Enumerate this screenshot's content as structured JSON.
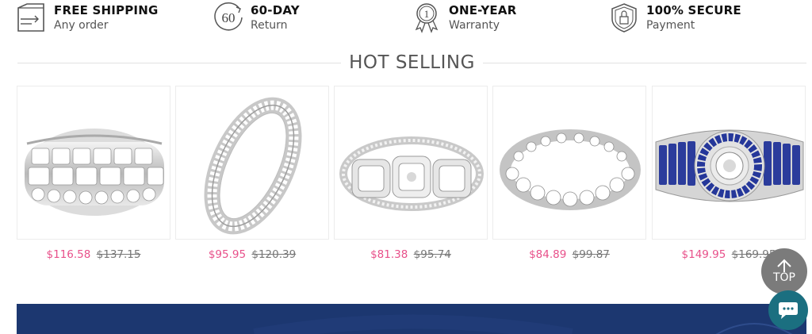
{
  "features": [
    {
      "icon": "truck-icon",
      "title": "FREE SHIPPING",
      "subtitle": "Any order"
    },
    {
      "icon": "sixty-day-return-icon",
      "title": "60-DAY",
      "subtitle": "Return",
      "icon_text": "60"
    },
    {
      "icon": "warranty-medal-icon",
      "title": "ONE-YEAR",
      "subtitle": "Warranty",
      "icon_text": "1"
    },
    {
      "icon": "secure-shield-icon",
      "title": "100% SECURE",
      "subtitle": "Payment"
    }
  ],
  "section": {
    "title": "HOT SELLING"
  },
  "products": [
    {
      "sale_price": "$116.58",
      "original_price": "$137.15",
      "image": "wide-diamond-eternity-band"
    },
    {
      "sale_price": "$95.95",
      "original_price": "$120.39",
      "image": "pave-diamond-band"
    },
    {
      "sale_price": "$81.38",
      "original_price": "$95.74",
      "image": "three-stone-halo-ring"
    },
    {
      "sale_price": "$84.89",
      "original_price": "$99.87",
      "image": "diamond-eternity-ring"
    },
    {
      "sale_price": "$149.95",
      "original_price": "$169.95",
      "image": "sapphire-halo-ring"
    }
  ],
  "floating": {
    "top_label": "TOP"
  },
  "colors": {
    "sale_price": "#e8508a",
    "banner": "#1c3770",
    "top_button": "#7b7b7b",
    "chat_button": "#1b6f80"
  }
}
